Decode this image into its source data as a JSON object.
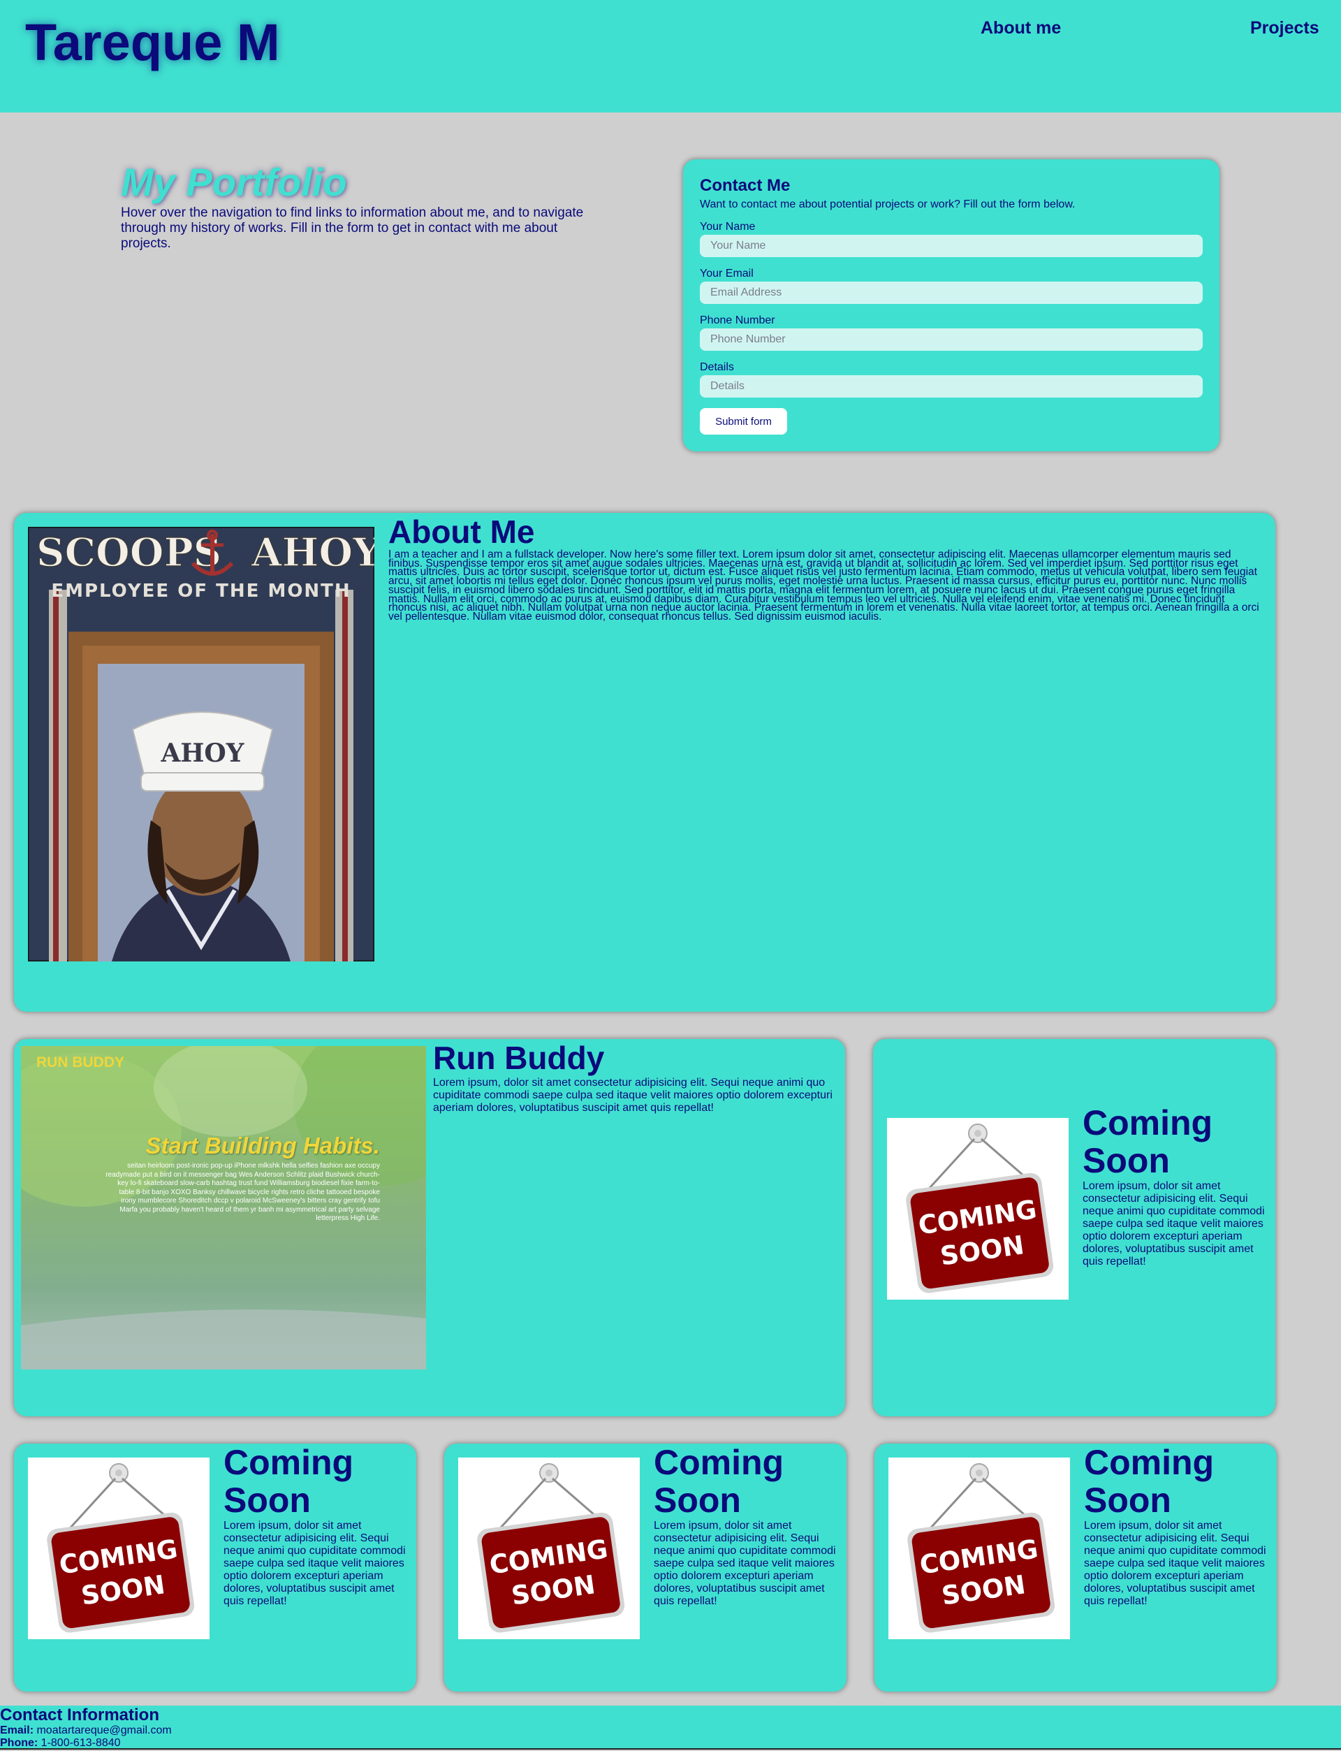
{
  "header": {
    "site_title": "Tareque M",
    "nav": [
      {
        "label": "About me"
      },
      {
        "label": "Projects"
      }
    ]
  },
  "intro": {
    "heading": "My Portfolio",
    "text": "Hover over the navigation to find links to information about me, and to navigate through my history of works. Fill in the form to get in contact with me about projects."
  },
  "contact_form": {
    "title": "Contact Me",
    "subtitle": "Want to contact me about potential projects or work? Fill out the form below.",
    "fields": [
      {
        "label": "Your Name",
        "placeholder": "Your Name",
        "value": ""
      },
      {
        "label": "Your Email",
        "placeholder": "Email Address",
        "value": ""
      },
      {
        "label": "Phone Number",
        "placeholder": "Phone Number",
        "value": ""
      },
      {
        "label": "Details",
        "placeholder": "Details",
        "value": ""
      }
    ],
    "submit_label": "Submit form"
  },
  "about": {
    "title": "About Me",
    "photo": {
      "banner_title_left": "SCOOPS",
      "banner_title_right": "AHOY",
      "banner_subtitle": "EMPLOYEE OF THE MONTH",
      "hat_text": "AHOY"
    },
    "body": "I am a teacher and I am a fullstack developer. Now here's some filler text. Lorem ipsum dolor sit amet, consectetur adipiscing elit. Maecenas ullamcorper elementum mauris sed finibus. Suspendisse tempor eros sit amet augue sodales ultricies. Maecenas urna est, gravida ut blandit at, sollicitudin ac lorem. Sed vel imperdiet ipsum. Sed porttitor risus eget mattis ultricies. Duis ac tortor suscipit, scelerisque tortor ut, dictum est. Fusce aliquet risus vel justo fermentum lacinia. Etiam commodo, metus ut vehicula volutpat, libero sem feugiat arcu, sit amet lobortis mi tellus eget dolor. Donec rhoncus ipsum vel purus mollis, eget molestie urna luctus. Praesent id massa cursus, efficitur purus eu, porttitor nunc. Nunc mollis suscipit felis, in euismod libero sodales tincidunt. Sed porttitor, elit id mattis porta, magna elit fermentum lorem, at posuere nunc lacus ut dui. Praesent congue purus eget fringilla mattis. Nullam elit orci, commodo ac purus at, euismod dapibus diam. Curabitur vestibulum tempus leo vel ultricies. Nulla vel eleifend enim, vitae venenatis mi. Donec tincidunt rhoncus nisi, ac aliquet nibh. Nullam volutpat urna non neque auctor lacinia. Praesent fermentum in lorem et venenatis. Nulla vitae laoreet tortor, at tempus orci. Aenean fringilla a orci vel pellentesque. Nullam vitae euismod dolor, consequat rhoncus tellus. Sed dignissim euismod iaculis."
  },
  "run_buddy": {
    "title": "Run Buddy",
    "body": "Lorem ipsum, dolor sit amet consectetur adipisicing elit. Sequi neque animi quo cupiditate commodi saepe culpa sed itaque velit maiores optio dolorem excepturi aperiam dolores, voluptatibus suscipit amet quis repellat!",
    "screenshot": {
      "brand": "RUN BUDDY",
      "headline": "Start Building Habits.",
      "copy": "seitan heirloom post-ironic pop-up iPhone mlkshk hella selfies fashion axe occupy readymade put a bird on it messenger bag Wes Anderson Schlitz plaid Bushwick church-key lo-fi skateboard slow-carb hashtag trust fund Williamsburg biodiesel fixie farm-to-table 8-bit banjo XOXO Banksy chillwave bicycle rights retro cliche tattooed bespoke irony mumblecore Shoreditch dccp v polaroid McSweeney's bitters cray gentrify tofu Marfa you probably haven't heard of them yr banh mi asymmetrical art party selvage letterpress High Life."
    }
  },
  "coming_soon_cards": [
    {
      "title": "Coming Soon",
      "body": "Lorem ipsum, dolor sit amet consectetur adipisicing elit. Sequi neque animi quo cupiditate commodi saepe culpa sed itaque velit maiores optio dolorem excepturi aperiam dolores, voluptatibus suscipit amet quis repellat!",
      "sign_line1": "COMING",
      "sign_line2": "SOON"
    },
    {
      "title": "Coming Soon",
      "body": "Lorem ipsum, dolor sit amet consectetur adipisicing elit. Sequi neque animi quo cupiditate commodi saepe culpa sed itaque velit maiores optio dolorem excepturi aperiam dolores, voluptatibus suscipit amet quis repellat!",
      "sign_line1": "COMING",
      "sign_line2": "SOON"
    },
    {
      "title": "Coming Soon",
      "body": "Lorem ipsum, dolor sit amet consectetur adipisicing elit. Sequi neque animi quo cupiditate commodi saepe culpa sed itaque velit maiores optio dolorem excepturi aperiam dolores, voluptatibus suscipit amet quis repellat!",
      "sign_line1": "COMING",
      "sign_line2": "SOON"
    },
    {
      "title": "Coming Soon",
      "body": "Lorem ipsum, dolor sit amet consectetur adipisicing elit. Sequi neque animi quo cupiditate commodi saepe culpa sed itaque velit maiores optio dolorem excepturi aperiam dolores, voluptatibus suscipit amet quis repellat!",
      "sign_line1": "COMING",
      "sign_line2": "SOON"
    }
  ],
  "footer": {
    "heading": "Contact Information",
    "email_label": "Email:",
    "email": "moatartareque@gmail.com",
    "phone_label": "Phone:",
    "phone": "1-800-613-8840"
  },
  "colors": {
    "accent": "#40e0d0",
    "text": "#0a0a7a",
    "background": "#cfcfcf",
    "sign_red": "#8b0000"
  }
}
